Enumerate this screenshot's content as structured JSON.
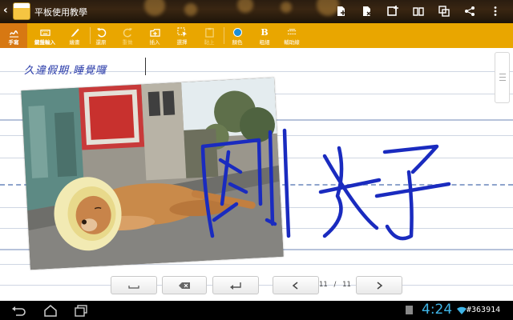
{
  "header": {
    "app_title": "平板使用教學"
  },
  "toolbar": {
    "items": [
      {
        "label": "手寫",
        "icon": "pen-icon"
      },
      {
        "label": "鍵盤輸入",
        "icon": "keyboard-icon"
      },
      {
        "label": "繪畫",
        "icon": "brush-icon"
      },
      {
        "label": "還原",
        "icon": "undo-icon"
      },
      {
        "label": "重做",
        "icon": "redo-icon"
      },
      {
        "label": "插入",
        "icon": "insert-icon"
      },
      {
        "label": "選擇",
        "icon": "select-icon"
      },
      {
        "label": "黏上",
        "icon": "paste-icon"
      },
      {
        "label": "顏色",
        "icon": "color-icon"
      },
      {
        "label": "粗細",
        "icon": "bold-icon",
        "glyph": "B"
      },
      {
        "label": "輔助線",
        "icon": "guideline-icon"
      }
    ],
    "color": "#1e8fd6"
  },
  "note": {
    "handwritten_title": "久違假期.睡覺囉",
    "handwritten_big": "剛好"
  },
  "pager": {
    "current": "11",
    "separator": "/",
    "total": "11"
  },
  "status": {
    "clock": "4:24",
    "watermark": "#363914"
  },
  "colors": {
    "toolbar": "#e9a600",
    "toolbar_active": "#d77812",
    "ink": "#1a2bbf",
    "clock": "#3fb4e6"
  }
}
